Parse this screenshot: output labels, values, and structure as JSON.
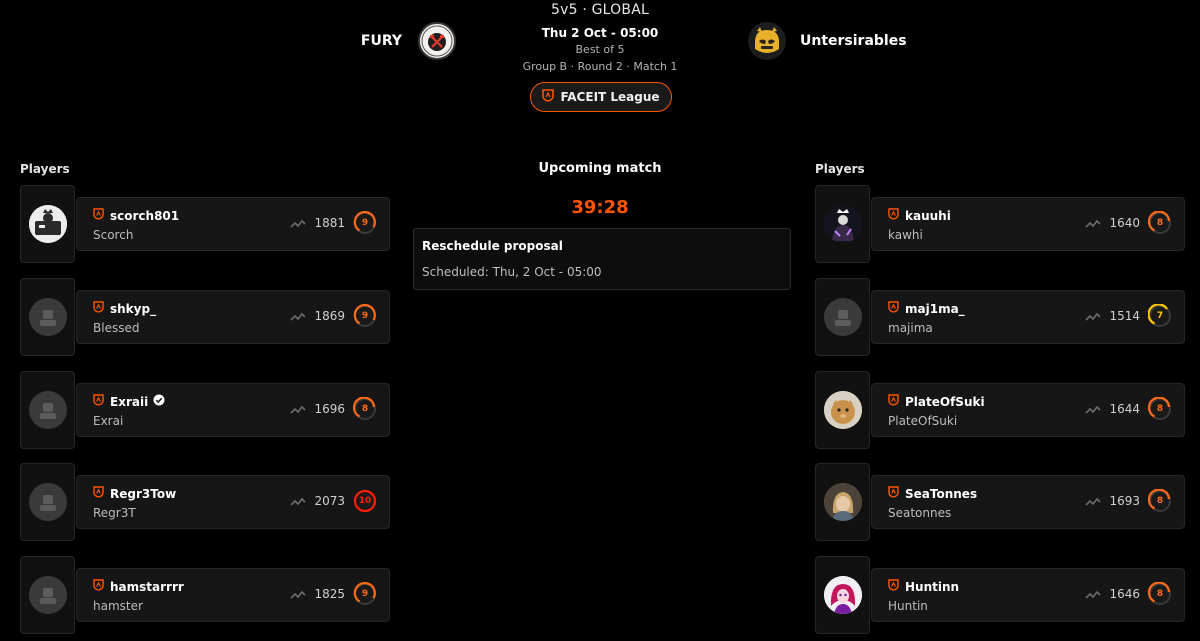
{
  "header": {
    "mode": "5v5 · GLOBAL",
    "date": "Thu 2 Oct - 05:00",
    "best_of": "Best of 5",
    "group_round": "Group B · Round 2 · Match 1",
    "league_label": "FACEIT League"
  },
  "team_left": {
    "name": "FURY",
    "logo_icon": "crossed-axes-logo"
  },
  "team_right": {
    "name": "Untersirables",
    "logo_icon": "yellow-mascot-logo"
  },
  "center": {
    "title": "Upcoming match",
    "timer": "39:28",
    "reschedule_title": "Reschedule proposal",
    "reschedule_text": "Scheduled: Thu, 2 Oct - 05:00"
  },
  "left": {
    "title": "Players",
    "players": [
      {
        "nick": "scorch801",
        "name": "Scorch",
        "elo": "1881",
        "level": "9",
        "level_color": "#ff6a14",
        "verified": false,
        "avatar": "custom"
      },
      {
        "nick": "shkyp_",
        "name": "Blessed",
        "elo": "1869",
        "level": "9",
        "level_color": "#ff6a14",
        "verified": false,
        "avatar": "default"
      },
      {
        "nick": "Exraii",
        "name": "Exrai",
        "elo": "1696",
        "level": "8",
        "level_color": "#ff6a14",
        "verified": true,
        "avatar": "default"
      },
      {
        "nick": "Regr3Tow",
        "name": "Regr3T",
        "elo": "2073",
        "level": "10",
        "level_color": "#fe1f00",
        "verified": false,
        "avatar": "default"
      },
      {
        "nick": "hamstarrrr",
        "name": "hamster",
        "elo": "1825",
        "level": "9",
        "level_color": "#ff6a14",
        "verified": false,
        "avatar": "default"
      }
    ]
  },
  "right": {
    "title": "Players",
    "players": [
      {
        "nick": "kauuhi",
        "name": "kawhi",
        "elo": "1640",
        "level": "8",
        "level_color": "#ff6a14",
        "verified": false,
        "avatar": "custom"
      },
      {
        "nick": "maj1ma_",
        "name": "majima",
        "elo": "1514",
        "level": "7",
        "level_color": "#ffc800",
        "verified": false,
        "avatar": "default"
      },
      {
        "nick": "PlateOfSuki",
        "name": "PlateOfSuki",
        "elo": "1644",
        "level": "8",
        "level_color": "#ff6a14",
        "verified": false,
        "avatar": "custom"
      },
      {
        "nick": "SeaTonnes",
        "name": "Seatonnes",
        "elo": "1693",
        "level": "8",
        "level_color": "#ff6a14",
        "verified": false,
        "avatar": "custom"
      },
      {
        "nick": "Huntinn",
        "name": "Huntin",
        "elo": "1646",
        "level": "8",
        "level_color": "#ff6a14",
        "verified": false,
        "avatar": "custom"
      }
    ]
  },
  "colors": {
    "accent": "#ff5500",
    "background": "#000000",
    "card": "#161616"
  }
}
